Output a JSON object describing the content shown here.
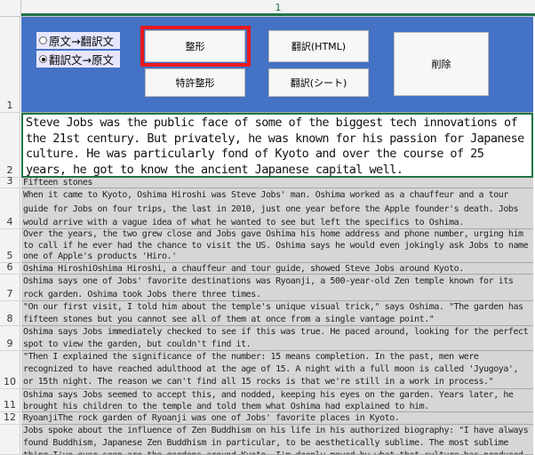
{
  "column_header": "1",
  "toolbar": {
    "radio_source_to_translation": "原文→翻訳文",
    "radio_translation_to_source": "翻訳文→原文",
    "btn_format": "整形",
    "btn_patent_format": "特許整形",
    "btn_translate_html": "翻訳(HTML)",
    "btn_translate_sheet": "翻訳(シート)",
    "btn_delete": "削除"
  },
  "rows": [
    {
      "num": "1",
      "text": ""
    },
    {
      "num": "2",
      "text": "Steve Jobs was the public face of some of the biggest tech innovations of the 21st century. But privately, he was known for his passion for Japanese culture. He was particularly fond of Kyoto and over the course of 25 years, he got to know the ancient Japanese capital well."
    },
    {
      "num": "3",
      "text": "Fifteen stones"
    },
    {
      "num": "4",
      "text": "When it came to Kyoto, Oshima Hiroshi was Steve Jobs' man. Oshima worked as a chauffeur and a tour guide for Jobs on four trips, the last in 2010, just one year before the Apple founder's death. Jobs would arrive with a vague idea of what he wanted to see but left the specifics to Oshima."
    },
    {
      "num": "5",
      "text": "Over the years, the two grew close and Jobs gave Oshima his home address and phone number, urging him to call if he ever had the chance to visit the US. Oshima says he would even jokingly ask Jobs to name one of Apple's products 'Hiro.'"
    },
    {
      "num": "6",
      "text": "Oshima HiroshiOshima Hiroshi, a chauffeur and tour guide, showed Steve Jobs around Kyoto."
    },
    {
      "num": "7",
      "text": "Oshima says one of Jobs' favorite destinations was Ryoanji, a 500-year-old Zen temple known for its rock garden. Oshima took Jobs there three times."
    },
    {
      "num": "8",
      "text": "\"On our first visit, I told him about the temple's unique visual trick,\" says Oshima. \"The garden has fifteen stones but you cannot see all of them at once from a single vantage point.\""
    },
    {
      "num": "9",
      "text": "Oshima says Jobs immediately checked to see if this was true. He paced around, looking for the perfect spot to view the garden, but couldn't find it."
    },
    {
      "num": "10",
      "text": "\"Then I explained the significance of the number: 15 means completion. In the past, men were recognized to have reached adulthood at the age of 15. A night with a full moon is called 'Jyugoya', or 15th night. The reason we can't find all 15 rocks is that we're still in a work in process.\""
    },
    {
      "num": "11",
      "text": "Oshima says Jobs seemed to accept this, and nodded, keeping his eyes on the garden. Years later, he brought his children to the temple and told them what Oshima had explained to him."
    },
    {
      "num": "12",
      "text": "RyoanjiThe rock garden of Ryoanji was one of Jobs' favorite places in Kyoto."
    },
    {
      "num": "",
      "text": "Jobs spoke about the influence of Zen Buddhism on his life in his authorized biography: \"I have always found Buddhism, Japanese Zen Buddhism in particular, to be aesthetically sublime. The most sublime thing I've ever seen are the gardens around Kyoto. I'm deeply moved by what that culture has produced, and it's directly from Zen Buddhism.\""
    }
  ]
}
